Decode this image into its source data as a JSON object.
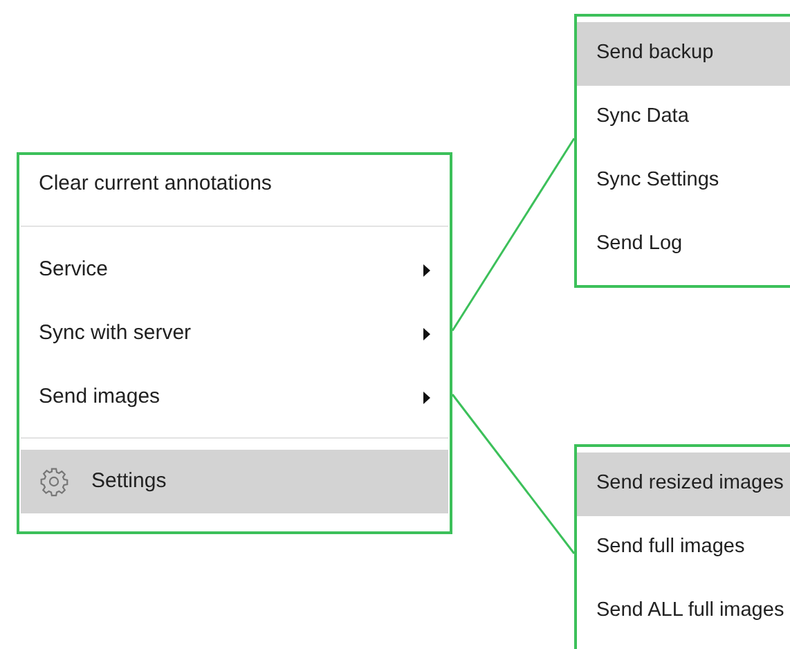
{
  "main_menu": {
    "groups": [
      [
        {
          "kind": "action",
          "label": "Clear current annotations",
          "selected": false
        }
      ],
      [
        {
          "kind": "submenu",
          "label": "Service",
          "expanded": false,
          "selected": false
        },
        {
          "kind": "submenu",
          "label": "Sync with server",
          "expanded": true,
          "selected": false
        },
        {
          "kind": "submenu",
          "label": "Send images",
          "expanded": true,
          "selected": false
        }
      ],
      [
        {
          "kind": "settings",
          "label": "Settings",
          "selected": true
        }
      ]
    ]
  },
  "submenus": [
    {
      "items": [
        {
          "label": "Send backup",
          "selected": true
        },
        {
          "label": "Sync Data",
          "selected": false
        },
        {
          "label": "Sync Settings",
          "selected": false
        },
        {
          "label": "Send Log",
          "selected": false
        }
      ]
    },
    {
      "items": [
        {
          "label": "Send resized images",
          "selected": true
        },
        {
          "label": "Send full images",
          "selected": false
        },
        {
          "label": "Send ALL full images",
          "selected": false
        }
      ]
    }
  ]
}
